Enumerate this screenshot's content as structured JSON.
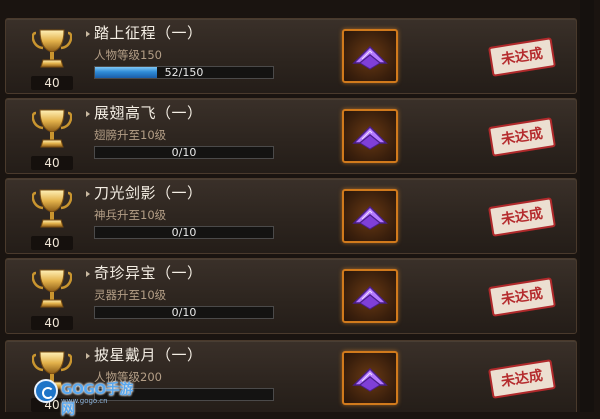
{
  "achievements": [
    {
      "title": "踏上征程（一）",
      "requirement": "人物等级150",
      "progress_text": "52/150",
      "progress": 0.347,
      "level": "40",
      "status": "未达成"
    },
    {
      "title": "展翅高飞（一）",
      "requirement": "翅膀升至10级",
      "progress_text": "0/10",
      "progress": 0,
      "level": "40",
      "status": "未达成"
    },
    {
      "title": "刀光剑影（一）",
      "requirement": "神兵升至10级",
      "progress_text": "0/10",
      "progress": 0,
      "level": "40",
      "status": "未达成"
    },
    {
      "title": "奇珍异宝（一）",
      "requirement": "灵器升至10级",
      "progress_text": "0/10",
      "progress": 0,
      "level": "40",
      "status": "未达成"
    },
    {
      "title": "披星戴月（一）",
      "requirement": "人物等级200",
      "progress_text": "",
      "progress": 0,
      "level": "40",
      "status": "未达成"
    }
  ],
  "icons": {
    "trophy": "gold-trophy-icon",
    "reward": "purple-chevron-crystal-icon"
  },
  "colors": {
    "progress_fill": "#2f8bd6",
    "reward_border": "#d17a1c",
    "stamp_red": "#b52c2e"
  },
  "watermark": {
    "brand": "GOGO手游网",
    "url": "www.gogo.cn"
  }
}
